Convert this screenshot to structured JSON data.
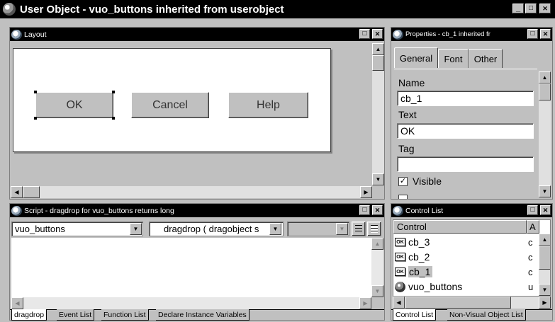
{
  "app": {
    "title": "User Object - vuo_buttons inherited from userobject",
    "controls": {
      "minimize": "_",
      "maximize": "□",
      "close": "✕"
    }
  },
  "layout": {
    "title": "Layout",
    "buttons": [
      "OK",
      "Cancel",
      "Help"
    ]
  },
  "properties": {
    "title": "Properties - cb_1 inherited fr",
    "tabs": [
      "General",
      "Font",
      "Other"
    ],
    "name_label": "Name",
    "name_value": "cb_1",
    "text_label": "Text",
    "text_value": "OK",
    "tag_label": "Tag",
    "tag_value": "",
    "visible_label": "Visible",
    "visible_checked": true
  },
  "script": {
    "title": "Script - dragdrop for vuo_buttons returns long",
    "object_select": "vuo_buttons",
    "event_select": "dragdrop ( dragobject s",
    "tabs": [
      "dragdrop",
      "Event List",
      "Function List",
      "Declare Instance Variables"
    ]
  },
  "control_list": {
    "title": "Control List",
    "columns": [
      "Control",
      "A"
    ],
    "rows": [
      {
        "name": "cb_3",
        "a": "c",
        "icon": "ok-button-icon"
      },
      {
        "name": "cb_2",
        "a": "c",
        "icon": "ok-button-icon"
      },
      {
        "name": "cb_1",
        "a": "c",
        "icon": "ok-button-icon"
      },
      {
        "name": "vuo_buttons",
        "a": "u",
        "icon": "user-object-icon"
      }
    ],
    "tabs": [
      "Control List",
      "Non-Visual Object List"
    ]
  }
}
